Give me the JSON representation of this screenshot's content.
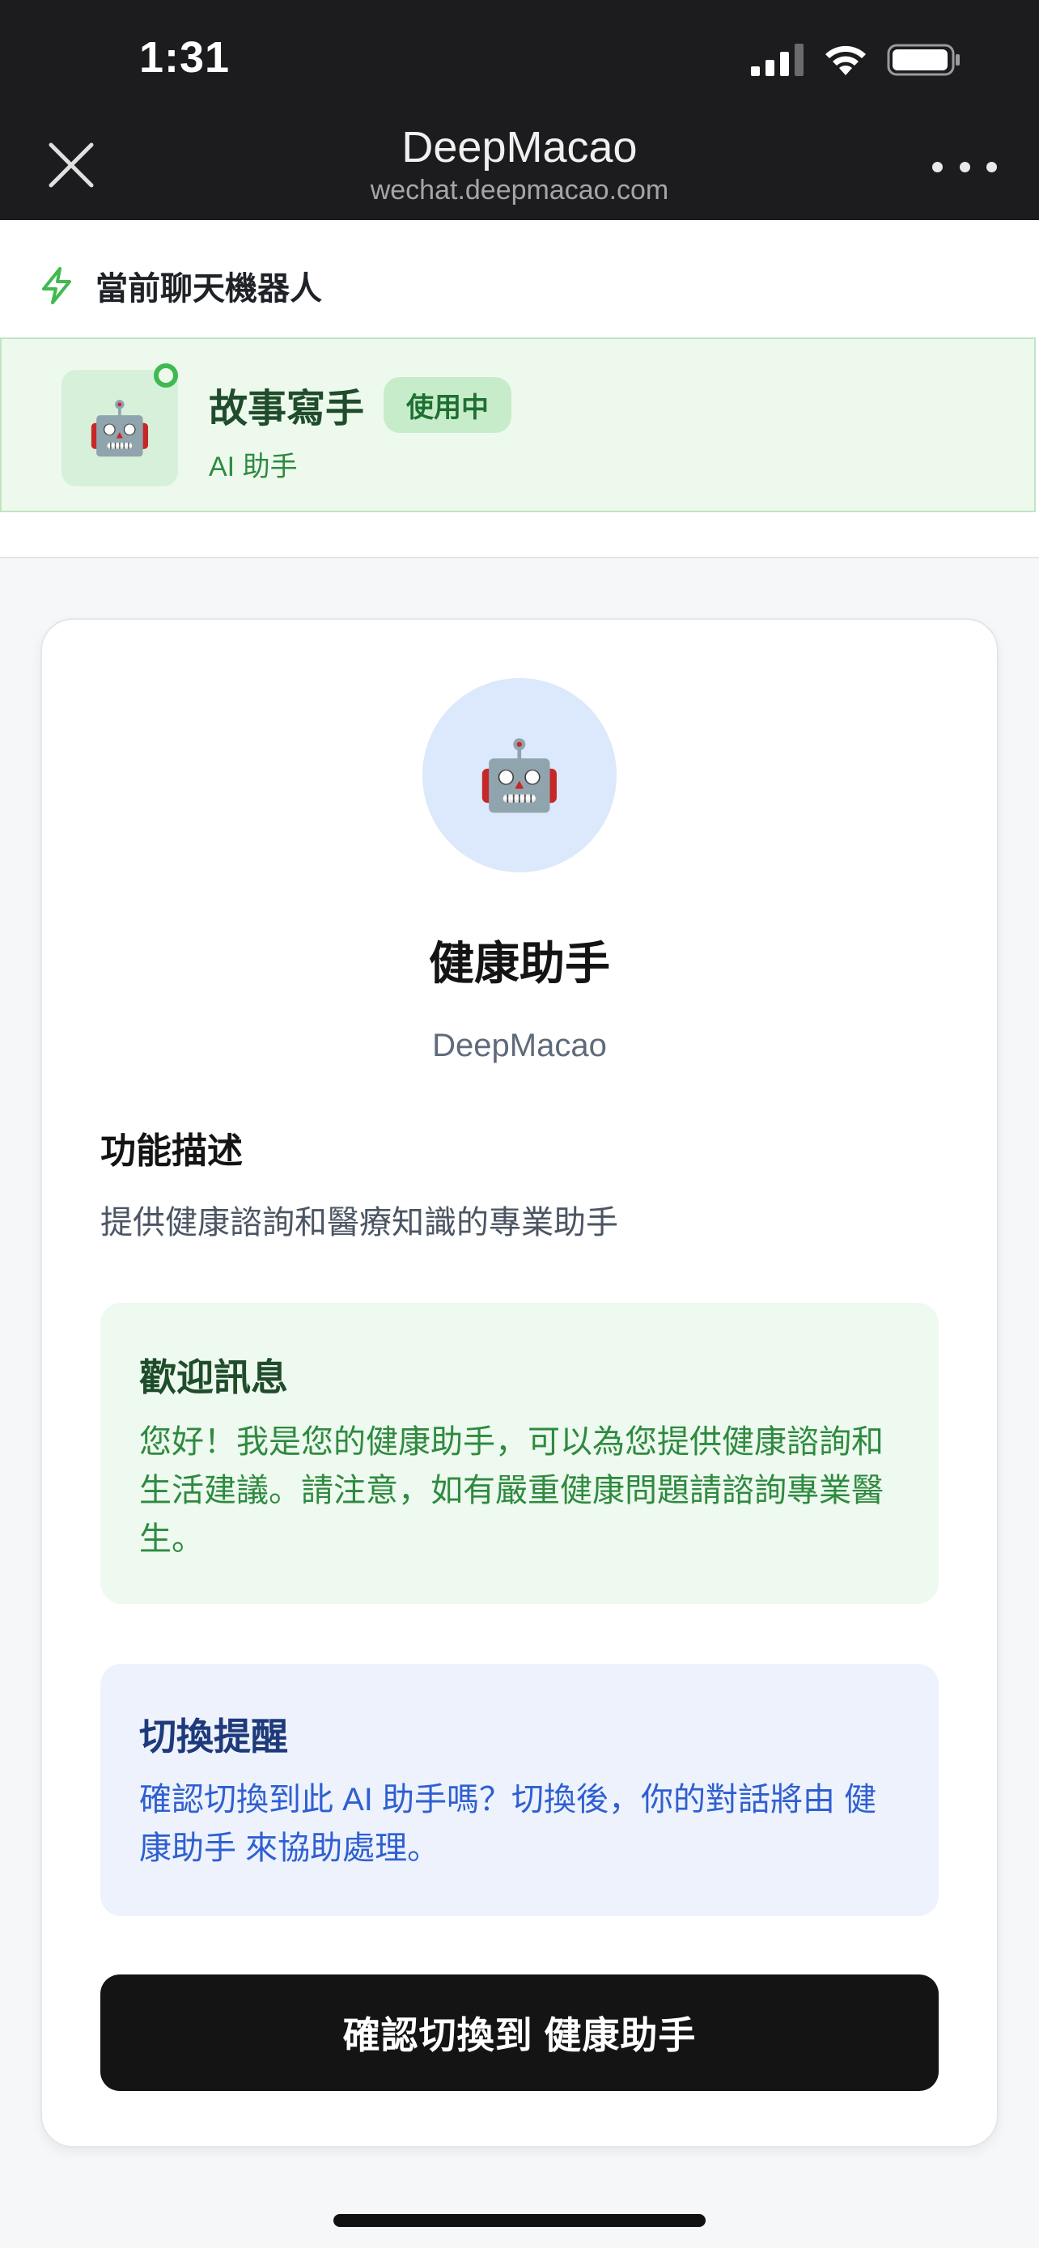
{
  "status_bar": {
    "time": "1:31"
  },
  "nav": {
    "title": "DeepMacao",
    "subtitle": "wechat.deepmacao.com"
  },
  "current": {
    "section_label": "當前聊天機器人",
    "bot_name": "故事寫手",
    "badge": "使用中",
    "bot_type": "AI 助手",
    "avatar_emoji": "🤖"
  },
  "bot": {
    "avatar_emoji": "🤖",
    "name": "健康助手",
    "provider": "DeepMacao",
    "description_heading": "功能描述",
    "description": "提供健康諮詢和醫療知識的專業助手"
  },
  "welcome": {
    "heading": "歡迎訊息",
    "text": "您好！我是您的健康助手，可以為您提供健康諮詢和生活建議。請注意，如有嚴重健康問題請諮詢專業醫生。"
  },
  "switch": {
    "heading": "切換提醒",
    "text": "確認切換到此 AI 助手嗎？切換後，你的對話將由 健康助手 來協助處理。"
  },
  "confirm_button_label": "確認切換到 健康助手",
  "colors": {
    "accent_green": "#3fb950",
    "accent_blue": "#2f5fd0",
    "button_dark": "#141414"
  }
}
